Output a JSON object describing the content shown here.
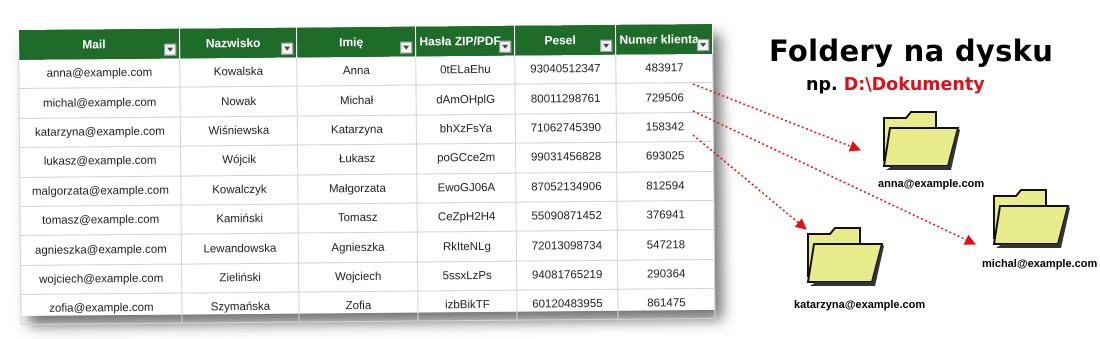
{
  "table": {
    "headers": [
      "Mail",
      "Nazwisko",
      "Imię",
      "Hasła ZIP/PDF",
      "Pesel",
      "Numer klienta"
    ],
    "rows": [
      [
        "anna@example.com",
        "Kowalska",
        "Anna",
        "0tELaEhu",
        "93040512347",
        "483917"
      ],
      [
        "michal@example.com",
        "Nowak",
        "Michał",
        "dAmOHplG",
        "80011298761",
        "729506"
      ],
      [
        "katarzyna@example.com",
        "Wiśniewska",
        "Katarzyna",
        "bhXzFsYa",
        "71062745390",
        "158342"
      ],
      [
        "lukasz@example.com",
        "Wójcik",
        "Łukasz",
        "poGCce2m",
        "99031456828",
        "693025"
      ],
      [
        "malgorzata@example.com",
        "Kowalczyk",
        "Małgorzata",
        "EwoGJ06A",
        "87052134906",
        "812594"
      ],
      [
        "tomasz@example.com",
        "Kamiński",
        "Tomasz",
        "CeZpH2H4",
        "55090871452",
        "376941"
      ],
      [
        "agnieszka@example.com",
        "Lewandowska",
        "Agnieszka",
        "RkIteNLg",
        "72013098734",
        "547218"
      ],
      [
        "wojciech@example.com",
        "Zieliński",
        "Wojciech",
        "5ssxLzPs",
        "94081765219",
        "290364"
      ],
      [
        "zofia@example.com",
        "Szymańska",
        "Zofia",
        "izbBikTF",
        "60120483955",
        "861475"
      ]
    ]
  },
  "heading": "Foldery na dysku",
  "subheading": {
    "prefix": "np. ",
    "path": "D:\\Dokumenty"
  },
  "folders": [
    {
      "label": "anna@example.com"
    },
    {
      "label": "michal@example.com"
    },
    {
      "label": "katarzyna@example.com"
    }
  ],
  "colors": {
    "header_bg": "#1f6b2a",
    "arrow": "#e0101a",
    "path_text": "#e0101a",
    "folder_fill": "#e8ec8a"
  }
}
